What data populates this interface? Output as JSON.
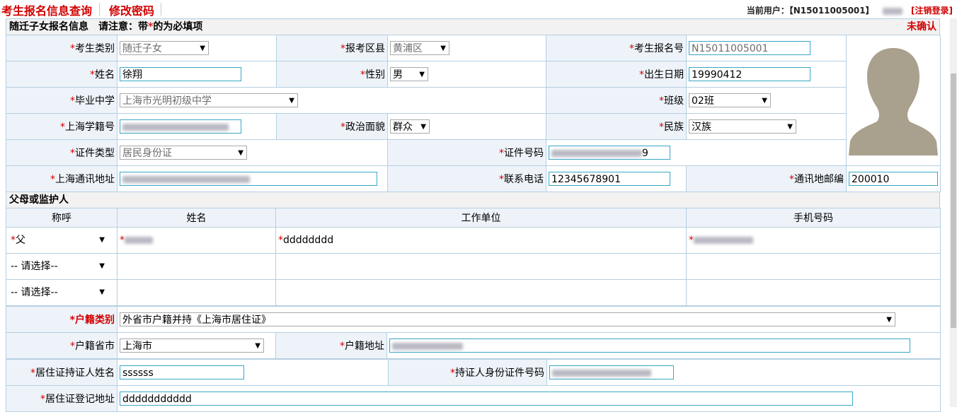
{
  "nav": {
    "query_link": "考生报名信息查询",
    "password_link": "修改密码"
  },
  "user": {
    "prefix": "当前用户：【",
    "id": "N15011005001",
    "close": "】",
    "logout": "[注销登录]"
  },
  "form": {
    "title": "随迁子女报名信息　请注意：带",
    "title_star": "*",
    "title_tail": "的为必填项",
    "status": "未确认",
    "star": "*",
    "fields": {
      "category": {
        "label": "考生类别",
        "value": "随迁子女"
      },
      "district": {
        "label": "报考区县",
        "value": "黄浦区"
      },
      "exam_no": {
        "label": "考生报名号",
        "value": "N15011005001"
      },
      "name": {
        "label": "姓名",
        "value": "徐翔"
      },
      "gender": {
        "label": "性别",
        "value": "男"
      },
      "birth": {
        "label": "出生日期",
        "value": "19990412"
      },
      "school": {
        "label": "毕业中学",
        "value": "上海市光明初级中学"
      },
      "class": {
        "label": "班级",
        "value": "02班"
      },
      "student_no": {
        "label": "上海学籍号"
      },
      "politics": {
        "label": "政治面貌",
        "value": "群众"
      },
      "ethnic": {
        "label": "民族",
        "value": "汉族"
      },
      "id_type": {
        "label": "证件类型",
        "value": "居民身份证"
      },
      "id_no": {
        "label": "证件号码",
        "value_tail": "9"
      },
      "address": {
        "label": "上海通讯地址"
      },
      "phone": {
        "label": "联系电话",
        "value": "12345678901"
      },
      "postcode": {
        "label": "通讯地邮编",
        "value": "200010"
      }
    },
    "parents": {
      "section": "父母或监护人",
      "columns": [
        "称呼",
        "姓名",
        "工作单位",
        "手机号码"
      ],
      "rows": [
        {
          "relation": "父",
          "employer": "dddddddd"
        },
        {
          "relation": "-- 请选择--",
          "employer": ""
        },
        {
          "relation": "-- 请选择--",
          "employer": ""
        }
      ]
    },
    "household": {
      "type_label": "户籍类别",
      "type_value": "外省市户籍并持《上海市居住证》",
      "province_label": "户籍省市",
      "province_value": "上海市",
      "address_label": "户籍地址",
      "holder_name_label": "居住证持证人姓名",
      "holder_name_value": "ssssss",
      "holder_id_label": "持证人身份证件号码",
      "reg_address_label": "居住证登记地址",
      "reg_address_value": "ddddddddddd"
    }
  },
  "colors": {
    "accent_red": "#d10000",
    "label_bg": "#eef3fa",
    "border": "#b5cfe0",
    "input_border": "#39a7c6"
  }
}
